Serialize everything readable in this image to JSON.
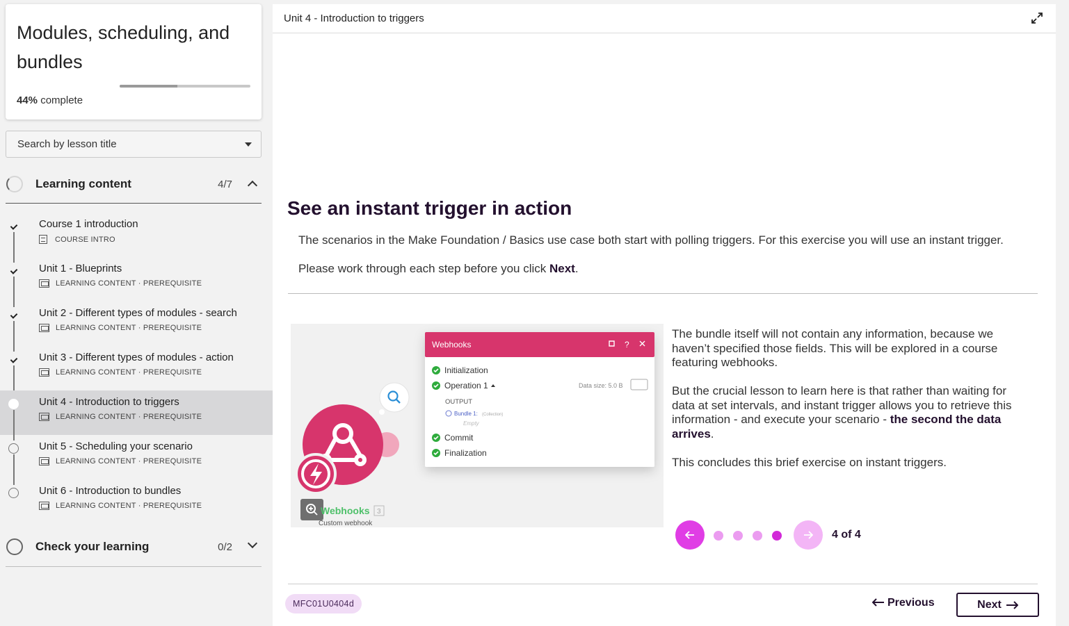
{
  "course": {
    "title": "Modules, scheduling, and bundles",
    "progress_percent": "44%",
    "progress_suffix": "complete",
    "progress_fraction": 0.44
  },
  "search": {
    "placeholder": "Search by lesson title"
  },
  "sections": [
    {
      "title": "Learning content",
      "count": "4/7",
      "expanded": true
    },
    {
      "title": "Check your learning",
      "count": "0/2",
      "expanded": false
    }
  ],
  "lessons": [
    {
      "title": "Course 1 introduction",
      "meta": "COURSE INTRO",
      "status": "done",
      "icon": "document-icon"
    },
    {
      "title": "Unit 1 - Blueprints",
      "meta": "LEARNING CONTENT · PREREQUISITE",
      "status": "done",
      "icon": "screen-icon"
    },
    {
      "title": "Unit 2 - Different types of modules - search",
      "meta": "LEARNING CONTENT · PREREQUISITE",
      "status": "done",
      "icon": "screen-icon"
    },
    {
      "title": "Unit 3 - Different types of modules - action",
      "meta": "LEARNING CONTENT · PREREQUISITE",
      "status": "done",
      "icon": "screen-icon"
    },
    {
      "title": "Unit 4 - Introduction to triggers",
      "meta": "LEARNING CONTENT · PREREQUISITE",
      "status": "current",
      "icon": "screen-icon"
    },
    {
      "title": "Unit 5 - Scheduling your scenario",
      "meta": "LEARNING CONTENT · PREREQUISITE",
      "status": "todo",
      "icon": "screen-icon"
    },
    {
      "title": "Unit 6 - Introduction to bundles",
      "meta": "LEARNING CONTENT · PREREQUISITE",
      "status": "todo",
      "icon": "screen-icon"
    }
  ],
  "main": {
    "header_title": "Unit 4 - Introduction to triggers",
    "heading": "See an instant trigger in action",
    "intro": "The scenarios in the Make Foundation / Basics use case both start with polling triggers. For this exercise you will use an instant trigger.",
    "instruction_prefix": "Please work through each step before you click ",
    "instruction_bold": "Next",
    "instruction_suffix": ".",
    "desc_1": "The bundle itself will not contain any information, because we haven’t specified those fields. This will be explored in a course featuring webhooks.",
    "desc_2_prefix": "But the crucial lesson to learn here is that rather than waiting for data at set intervals, and instant trigger allows you to retrieve this information - and execute your scenario - ",
    "desc_2_bold": "the second the data arrives",
    "desc_2_suffix": ".",
    "desc_3": "This concludes this brief exercise on instant triggers.",
    "carousel_count": "4 of 4",
    "carousel_total": 4,
    "carousel_current": 4,
    "lesson_code": "MFC01U0404d",
    "prev_label": "Previous",
    "next_label": "Next"
  },
  "figure": {
    "panel_title": "Webhooks",
    "steps": [
      "Initialization",
      "Operation 1",
      "Commit",
      "Finalization"
    ],
    "output_label": "OUTPUT",
    "bundle_label": "Bundle 1:",
    "bundle_type": "(Collection)",
    "empty_label": "Empty",
    "data_size": "Data size: 5.0 B",
    "module_name": "Webhooks",
    "module_badge": "3",
    "module_sub": "Custom webhook"
  },
  "colors": {
    "accent": "#e03de5",
    "brand_dark": "#23102e",
    "webhook_pink": "#d7356c",
    "success_green": "#2eab3c"
  }
}
